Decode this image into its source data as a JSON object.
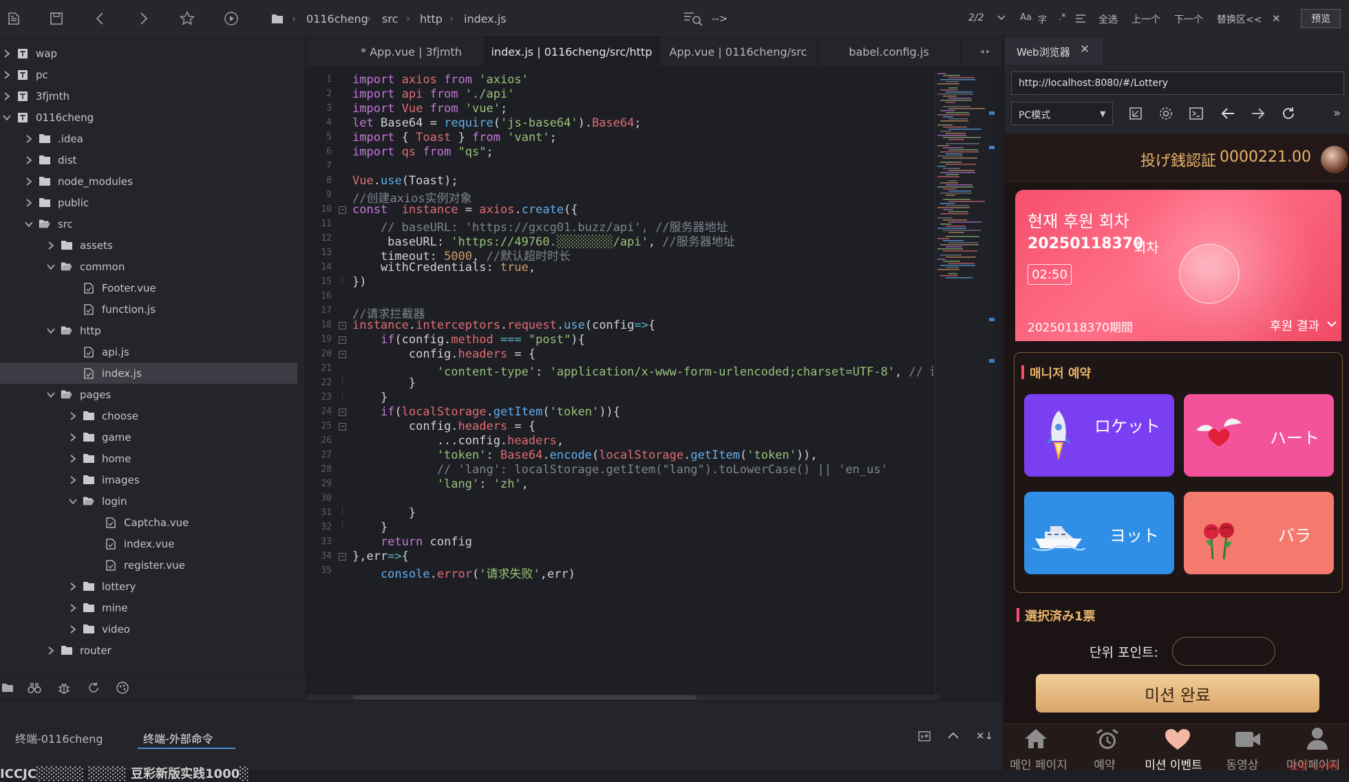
{
  "toolbar": {
    "breadcrumb": [
      "0116cheng",
      "src",
      "http",
      "index.js"
    ],
    "search_text": "-->",
    "match_count": "2/2",
    "opt_case": "Aa",
    "opt_word": "字",
    "opt_regex": ".*",
    "select_all": "全选",
    "prev": "上一个",
    "next": "下一个",
    "replace": "替换区<<",
    "close": "✕",
    "preview": "预览"
  },
  "sidebar": {
    "items": [
      {
        "label": "wap",
        "depth": 0,
        "kind": "project",
        "expanded": false
      },
      {
        "label": "pc",
        "depth": 0,
        "kind": "project",
        "expanded": false
      },
      {
        "label": "3fjmth",
        "depth": 0,
        "kind": "project",
        "expanded": false
      },
      {
        "label": "0116cheng",
        "depth": 0,
        "kind": "project",
        "expanded": true
      },
      {
        "label": ".idea",
        "depth": 1,
        "kind": "folder",
        "expanded": false
      },
      {
        "label": "dist",
        "depth": 1,
        "kind": "folder",
        "expanded": false
      },
      {
        "label": "node_modules",
        "depth": 1,
        "kind": "folder",
        "expanded": false
      },
      {
        "label": "public",
        "depth": 1,
        "kind": "folder",
        "expanded": false
      },
      {
        "label": "src",
        "depth": 1,
        "kind": "folder",
        "expanded": true
      },
      {
        "label": "assets",
        "depth": 2,
        "kind": "folder",
        "expanded": false
      },
      {
        "label": "common",
        "depth": 2,
        "kind": "folder",
        "expanded": true
      },
      {
        "label": "Footer.vue",
        "depth": 3,
        "kind": "file"
      },
      {
        "label": "function.js",
        "depth": 3,
        "kind": "file"
      },
      {
        "label": "http",
        "depth": 2,
        "kind": "folder",
        "expanded": true
      },
      {
        "label": "api.js",
        "depth": 3,
        "kind": "file"
      },
      {
        "label": "index.js",
        "depth": 3,
        "kind": "file",
        "selected": true
      },
      {
        "label": "pages",
        "depth": 2,
        "kind": "folder",
        "expanded": true
      },
      {
        "label": "choose",
        "depth": 3,
        "kind": "folder",
        "expanded": false
      },
      {
        "label": "game",
        "depth": 3,
        "kind": "folder",
        "expanded": false
      },
      {
        "label": "home",
        "depth": 3,
        "kind": "folder",
        "expanded": false
      },
      {
        "label": "images",
        "depth": 3,
        "kind": "folder",
        "expanded": false
      },
      {
        "label": "login",
        "depth": 3,
        "kind": "folder",
        "expanded": true
      },
      {
        "label": "Captcha.vue",
        "depth": 4,
        "kind": "file"
      },
      {
        "label": "index.vue",
        "depth": 4,
        "kind": "file"
      },
      {
        "label": "register.vue",
        "depth": 4,
        "kind": "file"
      },
      {
        "label": "lottery",
        "depth": 3,
        "kind": "folder",
        "expanded": false
      },
      {
        "label": "mine",
        "depth": 3,
        "kind": "folder",
        "expanded": false
      },
      {
        "label": "video",
        "depth": 3,
        "kind": "folder",
        "expanded": false
      },
      {
        "label": "router",
        "depth": 2,
        "kind": "folder",
        "expanded": false
      }
    ]
  },
  "tabs": [
    {
      "label": "* App.vue | 3fjmth",
      "active": false
    },
    {
      "label": "index.js | 0116cheng/src/http",
      "active": true
    },
    {
      "label": "App.vue | 0116cheng/src",
      "active": false
    },
    {
      "label": "babel.config.js",
      "active": false
    }
  ],
  "code": [
    [
      [
        "k",
        "import "
      ],
      [
        "v",
        "axios "
      ],
      [
        "k",
        "from "
      ],
      [
        "s",
        "'axios'"
      ]
    ],
    [
      [
        "k",
        "import "
      ],
      [
        "v",
        "api "
      ],
      [
        "k",
        "from "
      ],
      [
        "s",
        "'./api'"
      ]
    ],
    [
      [
        "k",
        "import "
      ],
      [
        "v",
        "Vue "
      ],
      [
        "k",
        "from "
      ],
      [
        "s",
        "'vue'"
      ],
      [
        "p",
        ";"
      ]
    ],
    [
      [
        "k",
        "let "
      ],
      [
        "p",
        "Base64 = "
      ],
      [
        "f",
        "require"
      ],
      [
        "p",
        "("
      ],
      [
        "s",
        "'js-base64'"
      ],
      [
        "p",
        ")."
      ],
      [
        "v",
        "Base64"
      ],
      [
        "p",
        ";"
      ]
    ],
    [
      [
        "k",
        "import "
      ],
      [
        "p",
        "{ "
      ],
      [
        "v",
        "Toast "
      ],
      [
        "p",
        "} "
      ],
      [
        "k",
        "from "
      ],
      [
        "s",
        "'vant'"
      ],
      [
        "p",
        ";"
      ]
    ],
    [
      [
        "k",
        "import "
      ],
      [
        "v",
        "qs "
      ],
      [
        "k",
        "from "
      ],
      [
        "s",
        "\"qs\""
      ],
      [
        "p",
        ";"
      ]
    ],
    [],
    [
      [
        "v",
        "Vue"
      ],
      [
        "p",
        "."
      ],
      [
        "f",
        "use"
      ],
      [
        "p",
        "(Toast);"
      ]
    ],
    [
      [
        "c",
        "//创建axios实例对象"
      ]
    ],
    [
      [
        "k",
        "const  "
      ],
      [
        "v",
        "instance "
      ],
      [
        "p",
        "= "
      ],
      [
        "v",
        "axios"
      ],
      [
        "p",
        "."
      ],
      [
        "f",
        "create"
      ],
      [
        "p",
        "({"
      ]
    ],
    [
      [
        "c",
        "    // baseURL: 'https://gxcg01.buzz/api', //服务器地址"
      ]
    ],
    [
      [
        "p",
        "     baseURL: "
      ],
      [
        "s",
        "'https://49760.░░░░░░░░/api'"
      ],
      [
        "p",
        ", "
      ],
      [
        "c",
        "//服务器地址"
      ]
    ],
    [
      [
        "p",
        "    timeout: "
      ],
      [
        "n",
        "5000"
      ],
      [
        "p",
        ", "
      ],
      [
        "c",
        "//默认超时时长"
      ]
    ],
    [
      [
        "p",
        "    withCredentials: "
      ],
      [
        "n",
        "true"
      ],
      [
        "p",
        ","
      ]
    ],
    [
      [
        "p",
        "})"
      ]
    ],
    [],
    [
      [
        "c",
        "//请求拦截器"
      ]
    ],
    [
      [
        "v",
        "instance"
      ],
      [
        "p",
        "."
      ],
      [
        "v",
        "interceptors"
      ],
      [
        "p",
        "."
      ],
      [
        "v",
        "request"
      ],
      [
        "p",
        "."
      ],
      [
        "f",
        "use"
      ],
      [
        "p",
        "(config"
      ],
      [
        "o",
        "=>"
      ],
      [
        "p",
        "{"
      ]
    ],
    [
      [
        "k",
        "    if"
      ],
      [
        "p",
        "(config."
      ],
      [
        "v",
        "method "
      ],
      [
        "o",
        "=== "
      ],
      [
        "s",
        "\"post\""
      ],
      [
        "p",
        "){"
      ]
    ],
    [
      [
        "p",
        "        config."
      ],
      [
        "v",
        "headers "
      ],
      [
        "p",
        "= {"
      ]
    ],
    [
      [
        "s",
        "            'content-type'"
      ],
      [
        "p",
        ": "
      ],
      [
        "s",
        "'application/x-www-form-urlencoded;charset=UTF-8'"
      ],
      [
        "p",
        ", "
      ],
      [
        "c",
        "// 设"
      ]
    ],
    [
      [
        "p",
        "        }"
      ]
    ],
    [
      [
        "p",
        "    }"
      ]
    ],
    [
      [
        "k",
        "    if"
      ],
      [
        "p",
        "("
      ],
      [
        "v",
        "localStorage"
      ],
      [
        "p",
        "."
      ],
      [
        "f",
        "getItem"
      ],
      [
        "p",
        "("
      ],
      [
        "s",
        "'token'"
      ],
      [
        "p",
        ")){"
      ]
    ],
    [
      [
        "p",
        "        config."
      ],
      [
        "v",
        "headers "
      ],
      [
        "p",
        "= {"
      ]
    ],
    [
      [
        "p",
        "            ...config."
      ],
      [
        "v",
        "headers"
      ],
      [
        "p",
        ","
      ]
    ],
    [
      [
        "s",
        "            'token'"
      ],
      [
        "p",
        ": "
      ],
      [
        "v",
        "Base64"
      ],
      [
        "p",
        "."
      ],
      [
        "f",
        "encode"
      ],
      [
        "p",
        "("
      ],
      [
        "v",
        "localStorage"
      ],
      [
        "p",
        "."
      ],
      [
        "f",
        "getItem"
      ],
      [
        "p",
        "("
      ],
      [
        "s",
        "'token'"
      ],
      [
        "p",
        ")),"
      ]
    ],
    [
      [
        "c",
        "            // 'lang': localStorage.getItem(\"lang\").toLowerCase() || 'en_us'"
      ]
    ],
    [
      [
        "s",
        "            'lang'"
      ],
      [
        "p",
        ": "
      ],
      [
        "s",
        "'zh'"
      ],
      [
        "p",
        ","
      ]
    ],
    [],
    [
      [
        "p",
        "        }"
      ]
    ],
    [
      [
        "p",
        "    }"
      ]
    ],
    [
      [
        "k",
        "    return "
      ],
      [
        "p",
        "config"
      ]
    ],
    [
      [
        "p",
        "},err"
      ],
      [
        "o",
        "=>"
      ],
      [
        "p",
        "{"
      ]
    ],
    [
      [
        "f",
        "    console"
      ],
      [
        "p",
        "."
      ],
      [
        "v",
        "error"
      ],
      [
        "p",
        "("
      ],
      [
        "s",
        "'请求失败'"
      ],
      [
        "p",
        ",err)"
      ]
    ]
  ],
  "browser": {
    "tab_title": "Web浏览器",
    "url": "http://localhost:8080/#/Lottery",
    "mode": "PC模式",
    "app": {
      "header_title": "投げ銭認証",
      "balance": "0000221.00",
      "round_label": "현재 후원 회차",
      "round_number": "20250118370",
      "round_suffix": "회차",
      "countdown": "02:50",
      "period_text": "20250118370期間",
      "result_link": "후원 결과",
      "section1_title": "매니저 예약",
      "options": [
        {
          "label": "ロケット",
          "icon": "rocket-icon",
          "color": "#7b3ff2"
        },
        {
          "label": "ハート",
          "icon": "winged-heart-icon",
          "color": "#f2539b"
        },
        {
          "label": "ヨット",
          "icon": "yacht-icon",
          "color": "#2f8fe6"
        },
        {
          "label": "バラ",
          "icon": "rose-icon",
          "color": "#f47a6e"
        }
      ],
      "section2_title": "選択済み1票",
      "points_label": "단위 포인트:",
      "points_value": "",
      "submit_label": "미션 완료",
      "nav": [
        {
          "label": "메인 페이지",
          "icon": "home-icon",
          "active": false
        },
        {
          "label": "예약",
          "icon": "alarm-clock-icon",
          "active": false
        },
        {
          "label": "미션 이벤트",
          "icon": "heart-icon",
          "active": true
        },
        {
          "label": "동영상",
          "icon": "video-icon",
          "active": false
        },
        {
          "label": "마이페이지",
          "icon": "user-icon",
          "active": false
        }
      ],
      "watermark": "云堂〵小明"
    }
  },
  "bottom": {
    "tabs": [
      {
        "label": "终端-0116cheng",
        "active": false
      },
      {
        "label": "终端-外部命令",
        "active": true
      }
    ],
    "terminal_line": "ICCJC░░░░░ ░░░░ 豆彩新版实践1000░"
  },
  "colors": {
    "accent_gold": "#e8b46a",
    "app_bg": "#1c1414",
    "card_pink": "#f5506d",
    "keyword": "#c678dd",
    "string": "#98c379",
    "function": "#61afef",
    "variable": "#e06c75"
  }
}
